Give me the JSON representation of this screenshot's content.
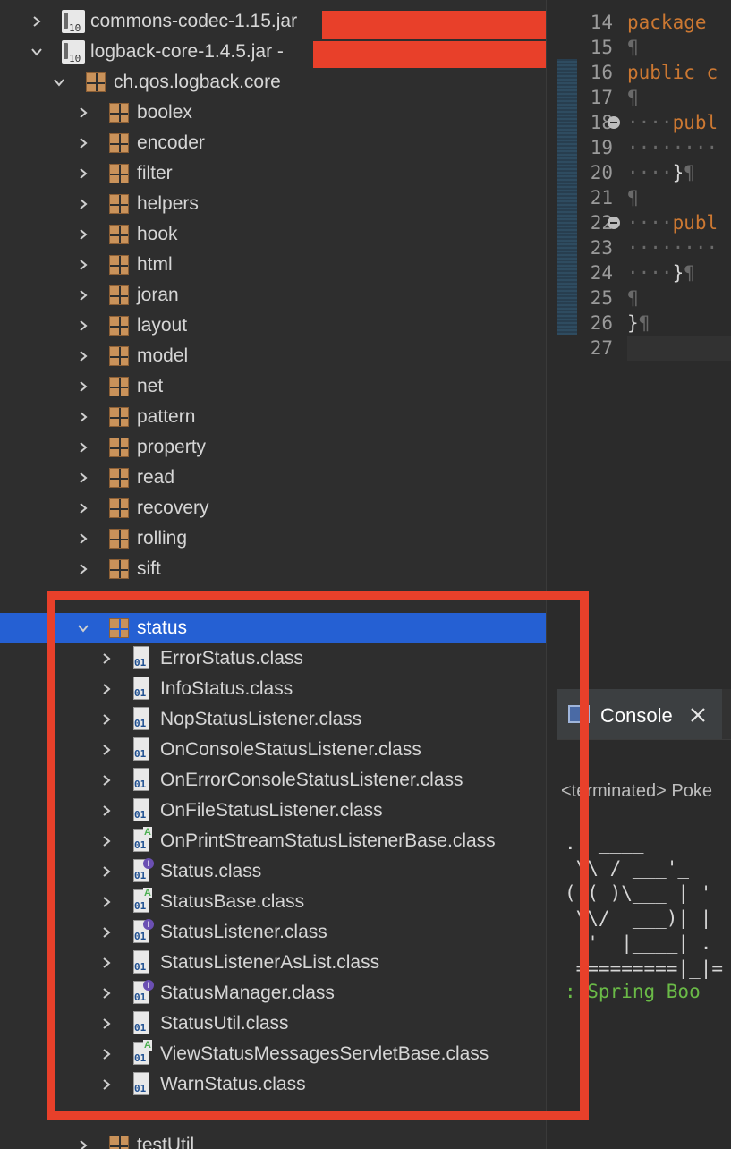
{
  "colors": {
    "selection": "#2560d3",
    "highlight_frame": "#e8402a",
    "redaction": "#e8402a",
    "keyword": "#cc7832",
    "spring_green": "#6aba47",
    "panel_bg": "#2e2e2e"
  },
  "tree": {
    "jars": [
      {
        "label": "commons-codec-1.15.jar",
        "expanded": false,
        "icon": "jar-icon"
      },
      {
        "label": "logback-core-1.4.5.jar",
        "suffix": " -",
        "expanded": true,
        "icon": "jar-icon"
      }
    ],
    "root_package": "ch.qos.logback.core",
    "packages": [
      "boolex",
      "encoder",
      "filter",
      "helpers",
      "hook",
      "html",
      "joran",
      "layout",
      "model",
      "net",
      "pattern",
      "property",
      "read",
      "recovery",
      "rolling",
      "sift"
    ],
    "selected_package": "status",
    "classes": [
      {
        "label": "ErrorStatus.class",
        "badge": ""
      },
      {
        "label": "InfoStatus.class",
        "badge": ""
      },
      {
        "label": "NopStatusListener.class",
        "badge": ""
      },
      {
        "label": "OnConsoleStatusListener.class",
        "badge": ""
      },
      {
        "label": "OnErrorConsoleStatusListener.class",
        "badge": ""
      },
      {
        "label": "OnFileStatusListener.class",
        "badge": ""
      },
      {
        "label": "OnPrintStreamStatusListenerBase.class",
        "badge": "A"
      },
      {
        "label": "Status.class",
        "badge": "I"
      },
      {
        "label": "StatusBase.class",
        "badge": "A"
      },
      {
        "label": "StatusListener.class",
        "badge": "I"
      },
      {
        "label": "StatusListenerAsList.class",
        "badge": ""
      },
      {
        "label": "StatusManager.class",
        "badge": "I"
      },
      {
        "label": "StatusUtil.class",
        "badge": ""
      },
      {
        "label": "ViewStatusMessagesServletBase.class",
        "badge": "A"
      },
      {
        "label": "WarnStatus.class",
        "badge": ""
      }
    ],
    "after_package": "testUtil",
    "class_file_text": "01"
  },
  "editor": {
    "lines": [
      {
        "num": "14",
        "text": "package",
        "kind": "kw",
        "fold": false
      },
      {
        "num": "15",
        "text": "¶",
        "kind": "pil",
        "fold": false
      },
      {
        "num": "16",
        "text": "public c",
        "kind": "kw",
        "fold": false
      },
      {
        "num": "17",
        "text": "¶",
        "kind": "pil",
        "fold": false
      },
      {
        "num": "18",
        "text": "····publ",
        "kind": "kw-indent",
        "fold": true
      },
      {
        "num": "19",
        "text": "········",
        "kind": "ws",
        "fold": false
      },
      {
        "num": "20",
        "text": "····}¶",
        "kind": "brace",
        "fold": false
      },
      {
        "num": "21",
        "text": "¶",
        "kind": "pil",
        "fold": false
      },
      {
        "num": "22",
        "text": "····publ",
        "kind": "kw-indent",
        "fold": true
      },
      {
        "num": "23",
        "text": "········",
        "kind": "ws",
        "fold": false
      },
      {
        "num": "24",
        "text": "····}¶",
        "kind": "brace",
        "fold": false
      },
      {
        "num": "25",
        "text": "¶",
        "kind": "pil",
        "fold": false
      },
      {
        "num": "26",
        "text": "}¶",
        "kind": "brace-root",
        "fold": false
      },
      {
        "num": "27",
        "text": "",
        "kind": "",
        "fold": false
      }
    ]
  },
  "console": {
    "tab_label": "Console",
    "status_text": "<terminated> Poke",
    "ascii_lines": [
      ".  ____",
      " \\\\ / ___'_",
      "( ( )\\___ | '",
      " \\\\/  ___)| |",
      "  '  |____| .",
      " =========|_|="
    ],
    "spring_line": ": Spring Boo"
  }
}
